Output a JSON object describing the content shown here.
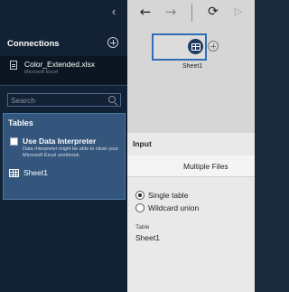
{
  "connections": {
    "title": "Connections",
    "item": {
      "name": "Color_Extended.xlsx",
      "subtitle": "Microsoft Excel"
    }
  },
  "search": {
    "placeholder": "Search"
  },
  "tables": {
    "title": "Tables",
    "data_interpreter": {
      "label": "Use Data Interpreter",
      "description": "Data Interpreter might be able to clean your Microsoft Excel workbook.",
      "checked": false
    },
    "items": [
      {
        "label": "Sheet1"
      }
    ]
  },
  "canvas": {
    "node_label": "Sheet1"
  },
  "input_panel": {
    "title": "Input",
    "tab": "Multiple Files",
    "options": [
      {
        "label": "Single table",
        "selected": true
      },
      {
        "label": "Wildcard union",
        "selected": false
      }
    ],
    "table_caption": "Table",
    "table_value": "Sheet1"
  },
  "colors": {
    "accent": "#2f6db5",
    "selection": "#34567d",
    "sidebar": "#122234"
  }
}
